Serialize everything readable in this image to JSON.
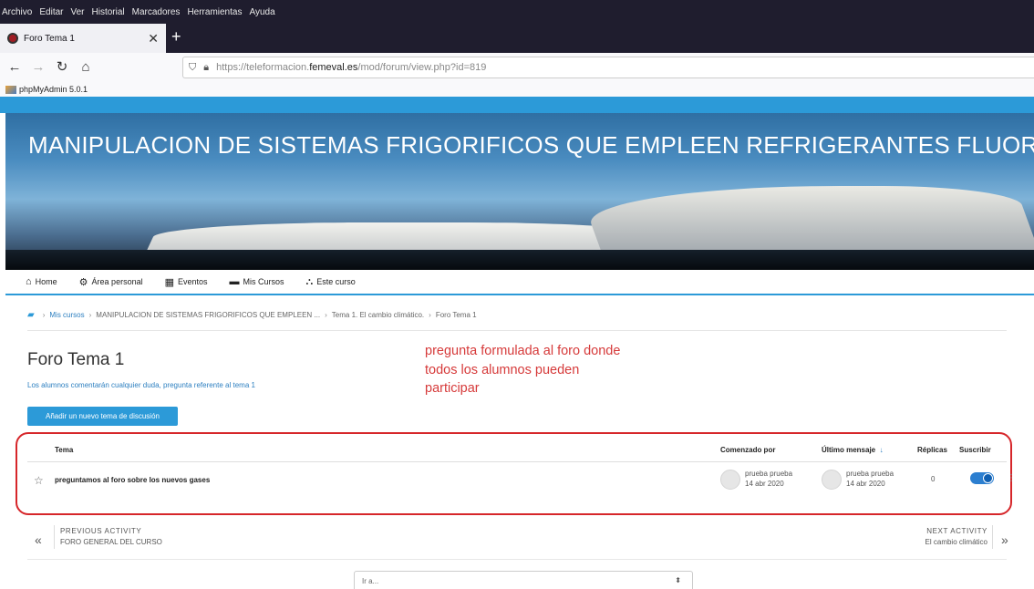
{
  "browser": {
    "menu": [
      "Archivo",
      "Editar",
      "Ver",
      "Historial",
      "Marcadores",
      "Herramientas",
      "Ayuda"
    ],
    "tab_title": "Foro Tema 1",
    "url_prefix": "https://teleformacion.",
    "url_domain": "femeval.es",
    "url_path": "/mod/forum/view.php?id=819",
    "bookmark": "phpMyAdmin 5.0.1"
  },
  "banner": {
    "title": "MANIPULACION DE SISTEMAS FRIGORIFICOS QUE EMPLEEN REFRIGERANTES FLUORADOS"
  },
  "nav": {
    "items": [
      {
        "label": "Home",
        "icon": "home-icon"
      },
      {
        "label": "Área personal",
        "icon": "dashboard-icon"
      },
      {
        "label": "Eventos",
        "icon": "calendar-icon"
      },
      {
        "label": "Mis Cursos",
        "icon": "briefcase-icon"
      },
      {
        "label": "Este curso",
        "icon": "sitemap-icon"
      }
    ]
  },
  "breadcrumb": {
    "items": [
      "Mis cursos",
      "MANIPULACION DE SISTEMAS FRIGORIFICOS QUE EMPLEEN ...",
      "Tema 1. El cambio climático.",
      "Foro Tema 1"
    ]
  },
  "forum": {
    "title": "Foro Tema 1",
    "description": "Los alumnos comentarán cualquier duda, pregunta referente al tema 1",
    "add_button": "Añadir un nuevo tema de discusión"
  },
  "annotation": "pregunta formulada al foro donde todos los alumnos pueden participar",
  "table": {
    "headers": {
      "topic": "Tema",
      "started_by": "Comenzado por",
      "last_post": "Último mensaje",
      "replies": "Réplicas",
      "subscribe": "Suscribir"
    },
    "rows": [
      {
        "topic": "preguntamos al foro sobre los nuevos gases",
        "started_name": "prueba prueba",
        "started_date": "14 abr 2020",
        "last_name": "prueba prueba",
        "last_date": "14 abr 2020",
        "replies": "0",
        "subscribed": true
      }
    ]
  },
  "activity": {
    "prev_label": "PREVIOUS ACTIVITY",
    "prev_name": "FORO GENERAL DEL CURSO",
    "next_label": "NEXT ACTIVITY",
    "next_name": "El cambio climático"
  },
  "jump": {
    "placeholder": "Ir a..."
  },
  "colors": {
    "accent": "#2c9ad8",
    "annotation": "#d63a3a",
    "box_border": "#d6262a"
  }
}
